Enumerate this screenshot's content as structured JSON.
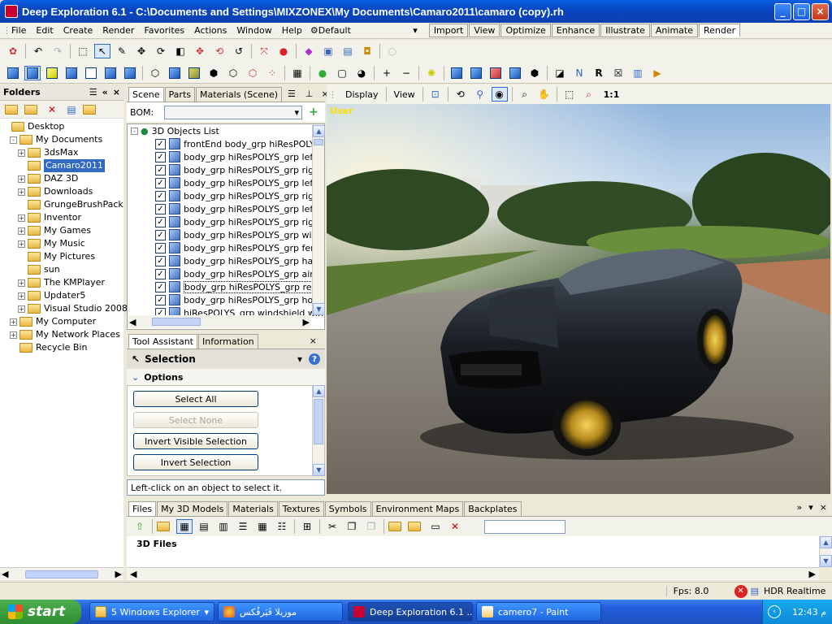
{
  "window": {
    "title": "Deep Exploration 6.1 - C:\\Documents and Settings\\MIXZONEX\\My Documents\\Camaro2011\\camaro (copy).rh",
    "min": "_",
    "max": "□",
    "close": "×"
  },
  "menu": [
    "File",
    "Edit",
    "Create",
    "Render",
    "Favorites",
    "Actions",
    "Window",
    "Help"
  ],
  "layout_dropdown": "Default",
  "mode_tabs": [
    "Import",
    "View",
    "Optimize",
    "Enhance",
    "Illustrate",
    "Animate",
    "Render"
  ],
  "mode_active": "Render",
  "folders": {
    "title": "Folders",
    "items": [
      {
        "label": "Desktop",
        "level": 0,
        "pm": ""
      },
      {
        "label": "My Documents",
        "level": 1,
        "pm": "-"
      },
      {
        "label": "3dsMax",
        "level": 2,
        "pm": "+"
      },
      {
        "label": "Camaro2011",
        "level": 2,
        "pm": "",
        "selected": true
      },
      {
        "label": "DAZ 3D",
        "level": 2,
        "pm": "+"
      },
      {
        "label": "Downloads",
        "level": 2,
        "pm": "+"
      },
      {
        "label": "GrungeBrushPack",
        "level": 2,
        "pm": ""
      },
      {
        "label": "Inventor",
        "level": 2,
        "pm": "+"
      },
      {
        "label": "My Games",
        "level": 2,
        "pm": "+"
      },
      {
        "label": "My Music",
        "level": 2,
        "pm": "+"
      },
      {
        "label": "My Pictures",
        "level": 2,
        "pm": ""
      },
      {
        "label": "sun",
        "level": 2,
        "pm": ""
      },
      {
        "label": "The KMPlayer",
        "level": 2,
        "pm": "+"
      },
      {
        "label": "Updater5",
        "level": 2,
        "pm": "+"
      },
      {
        "label": "Visual Studio 2008",
        "level": 2,
        "pm": "+"
      },
      {
        "label": "My Computer",
        "level": 1,
        "pm": "+"
      },
      {
        "label": "My Network Places",
        "level": 1,
        "pm": "+"
      },
      {
        "label": "Recycle Bin",
        "level": 1,
        "pm": ""
      }
    ]
  },
  "scene": {
    "tabs": [
      "Scene",
      "Parts",
      "Materials (Scene)"
    ],
    "bom_label": "BOM:",
    "root": "3D Objects List",
    "objects": [
      "frontEnd body_grp hiResPOLYS_",
      "body_grp hiResPOLYS_grp leftFr",
      "body_grp hiResPOLYS_grp rightF",
      "body_grp hiResPOLYS_grp leftD",
      "body_grp hiResPOLYS_grp rightI",
      "body_grp hiResPOLYS_grp leftR",
      "body_grp hiResPOLYS_grp rightI",
      "body_grp hiResPOLYS_grp wiper",
      "body_grp hiResPOLYS_grp fende",
      "body_grp hiResPOLYS_grp hatch",
      "body_grp hiResPOLYS_grp airfoi",
      "body_grp hiResPOLYS_grp rearB",
      "body_grp hiResPOLYS_grp hood",
      "hiResPOLYS_grp windshield wind"
    ],
    "highlighted_index": 11
  },
  "tool": {
    "tabs": [
      "Tool Assistant",
      "Information"
    ],
    "mode": "Selection",
    "options_label": "Options",
    "buttons": [
      {
        "label": "Select All",
        "disabled": false
      },
      {
        "label": "Select None",
        "disabled": true
      },
      {
        "label": "Invert Visible Selection",
        "disabled": false
      },
      {
        "label": "Invert Selection",
        "disabled": false
      }
    ],
    "hint": "Left-click on an object to select it."
  },
  "viewport": {
    "toolbar": [
      "Display",
      "View"
    ],
    "zoom": "1:1",
    "camera_label": "User"
  },
  "bottom": {
    "tabs": [
      "Files",
      "My 3D Models",
      "Materials",
      "Textures",
      "Symbols",
      "Environment Maps",
      "Backplates"
    ],
    "heading": "3D Files"
  },
  "status": {
    "fps": "Fps:  8.0",
    "render": "HDR Realtime"
  },
  "taskbar": {
    "start": "start",
    "tasks": [
      {
        "label": "5 Windows Explorer",
        "active": false
      },
      {
        "label": "موزيلا فَيَرفُكس",
        "active": false
      },
      {
        "label": "Deep Exploration 6.1 ...",
        "active": true
      },
      {
        "label": "camero7 - Paint",
        "active": false
      }
    ],
    "clock": "12:43 م"
  }
}
